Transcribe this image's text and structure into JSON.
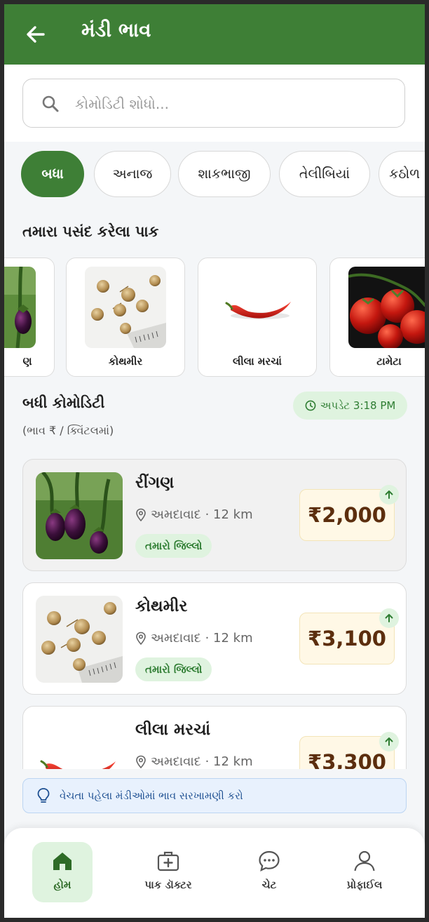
{
  "header": {
    "title": "મંડી ભાવ"
  },
  "search": {
    "placeholder": "કોમોડિટી શોધો..."
  },
  "filters": [
    {
      "label": "બધા",
      "active": true
    },
    {
      "label": "અનાજ",
      "active": false
    },
    {
      "label": "શાકભાજી",
      "active": false
    },
    {
      "label": "તેલીબિયાં",
      "active": false
    },
    {
      "label": "કઠોળ",
      "active": false
    }
  ],
  "favorites": {
    "title": "તમારા પસંદ કરેલા પાક",
    "items": [
      {
        "label": "ણ",
        "icon": "brinjal-image"
      },
      {
        "label": "કોથમીર",
        "icon": "coriander-seed-image"
      },
      {
        "label": "લીલા મરચાં",
        "icon": "green-chilli-image"
      },
      {
        "label": "ટામેટા",
        "icon": "tomato-image"
      }
    ]
  },
  "commodities": {
    "title": "બધી કોમોડિટી",
    "unit_note": "(ભાવ ₹ / ક્વિંટલમાં)",
    "updated": "અપડેટ 3:18 PM",
    "items": [
      {
        "name": "રીંગણ",
        "location": "અમદાવાદ · 12 km",
        "tag": "તમારો જિલ્લો",
        "price": "₹2,000",
        "trend": "up",
        "icon": "brinjal-image"
      },
      {
        "name": "કોથમીર",
        "location": "અમદાવાદ · 12 km",
        "tag": "તમારો જિલ્લો",
        "price": "₹3,100",
        "trend": "up",
        "icon": "coriander-seed-image"
      },
      {
        "name": "લીલા મરચાં",
        "location": "અમદાવાદ · 12 km",
        "tag": "",
        "price": "₹3,300",
        "trend": "up",
        "icon": "green-chilli-image"
      }
    ]
  },
  "tip": {
    "text": "વેચતા પહેલા મંડીઓમાં ભાવ સરખામણી કરો"
  },
  "nav": [
    {
      "label": "હોમ",
      "icon": "home-icon",
      "active": true
    },
    {
      "label": "પાક ડૉક્ટર",
      "icon": "medical-kit-icon",
      "active": false
    },
    {
      "label": "ચેટ",
      "icon": "chat-icon",
      "active": false
    },
    {
      "label": "પ્રોફાઈલ",
      "icon": "profile-icon",
      "active": false
    }
  ],
  "colors": {
    "primary": "#3e7f36",
    "price_text": "#5c2e0e",
    "price_bg": "#fff8e6",
    "tag_bg": "#dff3df",
    "tip_bg": "#e8f1fd"
  }
}
